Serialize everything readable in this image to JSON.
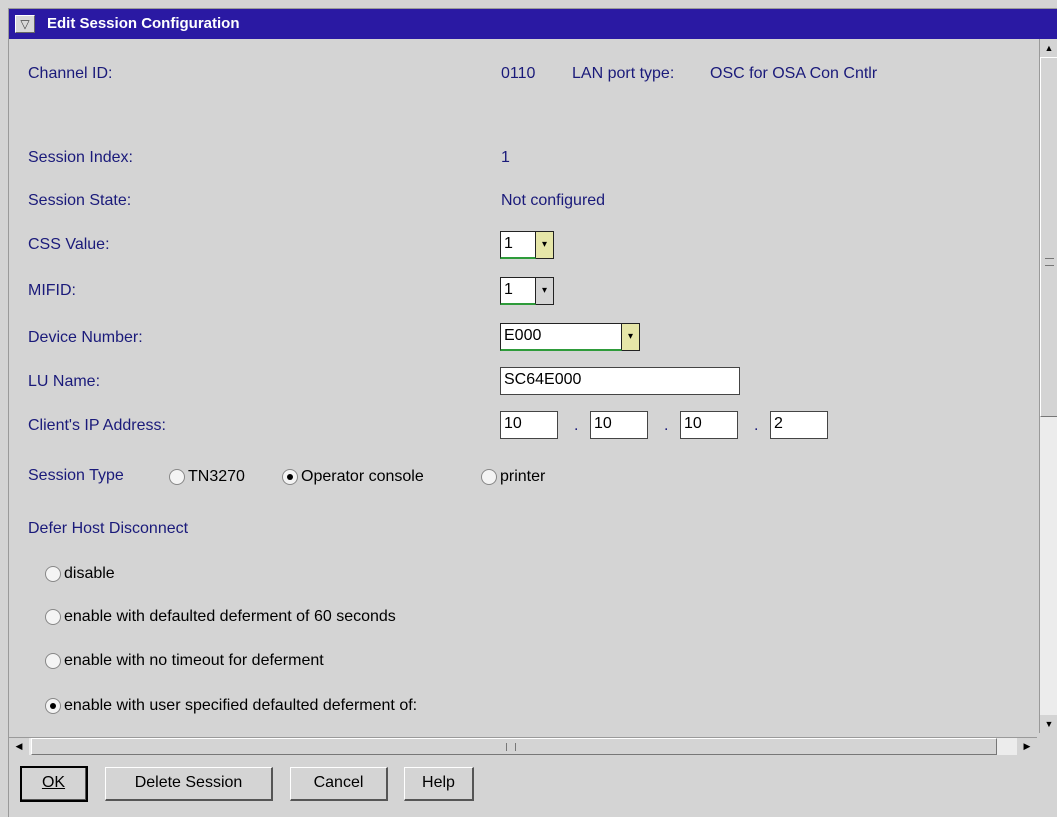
{
  "window": {
    "title": "Edit Session Configuration",
    "sysmenu_glyph": "▽"
  },
  "channel": {
    "label": "Channel ID:",
    "value": "0110",
    "port_label": "LAN port type:",
    "port_value": "OSC for OSA Con Cntlr"
  },
  "session_index": {
    "label": "Session Index:",
    "value": "1"
  },
  "session_state": {
    "label": "Session State:",
    "value": "Not configured"
  },
  "css_value": {
    "label": "CSS Value:",
    "value": "1"
  },
  "mifid": {
    "label": "MIFID:",
    "value": "1"
  },
  "device_number": {
    "label": "Device Number:",
    "value": "E000"
  },
  "lu_name": {
    "label": "LU Name:",
    "value": "SC64E000"
  },
  "client_ip": {
    "label": "Client's IP Address:",
    "octets": [
      "10",
      "10",
      "10",
      "2"
    ],
    "separator": "."
  },
  "session_type": {
    "label": "Session Type",
    "options": [
      {
        "label": "TN3270",
        "selected": false
      },
      {
        "label": "Operator console",
        "selected": true
      },
      {
        "label": "printer",
        "selected": false
      }
    ]
  },
  "defer": {
    "label": "Defer Host Disconnect",
    "options": [
      {
        "label": "disable",
        "selected": false
      },
      {
        "label": "enable with defaulted deferment of 60 seconds",
        "selected": false
      },
      {
        "label": "enable with no timeout for deferment",
        "selected": false
      },
      {
        "label": "enable with user specified defaulted deferment of:",
        "selected": true
      }
    ]
  },
  "buttons": {
    "ok": "OK",
    "delete": "Delete Session",
    "cancel": "Cancel",
    "help": "Help"
  },
  "icons": {
    "dropdown": "▾",
    "scroll_up": "▲",
    "scroll_down": "▼",
    "scroll_left": "◀",
    "scroll_right": "▶"
  },
  "colors": {
    "title_bar": "#2a19a3",
    "label_text": "#1a1a7a",
    "focus_underline": "#2e9b3a"
  }
}
